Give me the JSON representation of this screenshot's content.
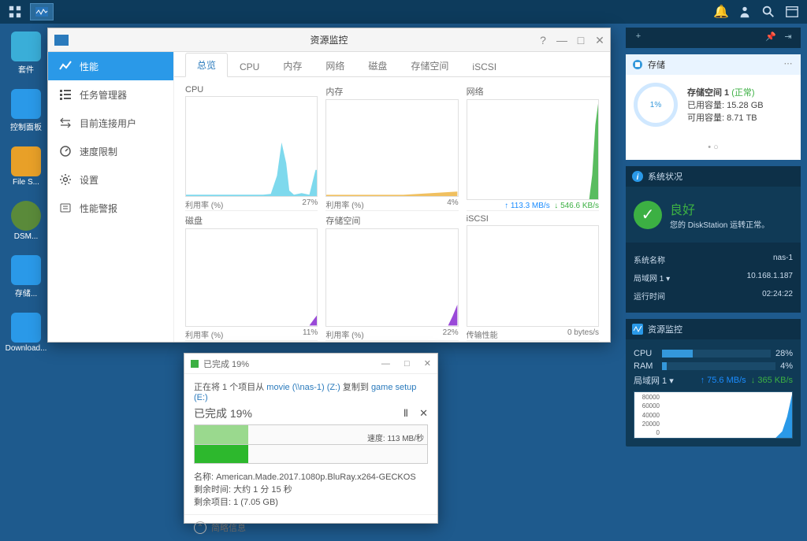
{
  "taskbar": {},
  "desktop": {
    "icons": [
      "套件",
      "控制面板",
      "File S...",
      "DSM...",
      "存储...",
      "Download..."
    ]
  },
  "main_window": {
    "title": "资源监控",
    "sidebar": [
      {
        "label": "性能",
        "active": true
      },
      {
        "label": "任务管理器"
      },
      {
        "label": "目前连接用户"
      },
      {
        "label": "速度限制"
      },
      {
        "label": "设置"
      },
      {
        "label": "性能警报"
      }
    ],
    "tabs": [
      "总览",
      "CPU",
      "内存",
      "网络",
      "磁盘",
      "存储空间",
      "iSCSI"
    ],
    "active_tab": 0,
    "charts": [
      {
        "title": "CPU",
        "foot_l": "利用率 (%)",
        "foot_r": "27%"
      },
      {
        "title": "内存",
        "foot_l": "利用率 (%)",
        "foot_r": "4%"
      },
      {
        "title": "网络",
        "foot_up": "113.3 MB/s",
        "foot_dn": "546.6 KB/s"
      },
      {
        "title": "磁盘",
        "foot_l": "利用率 (%)",
        "foot_r": "11%"
      },
      {
        "title": "存储空间",
        "foot_l": "利用率 (%)",
        "foot_r": "22%"
      },
      {
        "title": "iSCSI",
        "foot_l": "传输性能",
        "foot_r": "0 bytes/s"
      }
    ]
  },
  "copy_dialog": {
    "title": "已完成 19%",
    "line1_a": "正在将 1 个项目从 ",
    "src": "movie (\\\\nas-1) (Z:)",
    "line1_b": " 复制到 ",
    "dst": "game setup (E:)",
    "progress_label": "已完成 19%",
    "speed_label": "速度: 113 MB/秒",
    "name_label": "名称: American.Made.2017.1080p.BluRay.x264-GECKOS",
    "remain_time": "剩余时间: 大约 1 分 15 秒",
    "remain_items": "剩余项目: 1 (7.05 GB)",
    "brief": "简略信息"
  },
  "storage_panel": {
    "title": "存储",
    "vol_name": "存储空间 1",
    "status": "(正常)",
    "used": "已用容量: 15.28 GB",
    "avail": "可用容量: 8.71 TB",
    "pct": "1%"
  },
  "sys_panel": {
    "title": "系统状况",
    "status": "良好",
    "msg": "您的 DiskStation 运转正常。",
    "rows": [
      {
        "k": "系统名称",
        "v": "nas-1"
      },
      {
        "k": "局域网 1 ▾",
        "v": "10.168.1.187"
      },
      {
        "k": "运行时间",
        "v": "02:24:22"
      }
    ]
  },
  "res_panel": {
    "title": "资源监控",
    "cpu": {
      "label": "CPU",
      "pct": "28%",
      "val": 28
    },
    "ram": {
      "label": "RAM",
      "pct": "4%",
      "val": 4
    },
    "net": {
      "label": "局域网 1 ▾",
      "up": "75.6 MB/s",
      "dn": "365 KB/s"
    },
    "ylabels": [
      "80000",
      "60000",
      "40000",
      "20000",
      "0"
    ]
  },
  "chart_data": [
    {
      "type": "area",
      "title": "CPU",
      "ylabel": "利用率 (%)",
      "ylim": [
        0,
        100
      ],
      "values": [
        1,
        1,
        1,
        1,
        1,
        1,
        1,
        1,
        1,
        1,
        1,
        1,
        2,
        2,
        2,
        2,
        2,
        2,
        2,
        2,
        4,
        20,
        45,
        30,
        5,
        2,
        1,
        2,
        1,
        27
      ]
    },
    {
      "type": "area",
      "title": "内存",
      "ylabel": "利用率 (%)",
      "ylim": [
        0,
        100
      ],
      "values": [
        2,
        2,
        2,
        2,
        2,
        2,
        2,
        2,
        2,
        2,
        2,
        2,
        2,
        2,
        2,
        2,
        2,
        2,
        2,
        2,
        3,
        3,
        3,
        4,
        4,
        4,
        4,
        4,
        4,
        4
      ]
    },
    {
      "type": "area",
      "title": "网络",
      "series": [
        {
          "name": "up",
          "values": [
            0,
            0,
            0,
            0,
            0,
            0,
            0,
            0,
            0,
            0,
            0,
            0,
            0,
            0,
            0,
            0,
            0,
            0,
            0,
            0,
            0,
            0,
            0,
            0,
            0,
            0,
            0,
            20,
            80,
            113.3
          ]
        },
        {
          "name": "down",
          "values": [
            0,
            0,
            0,
            0,
            0,
            0,
            0,
            0,
            0,
            0,
            0,
            0,
            0,
            0,
            0,
            0,
            0,
            0,
            0,
            0,
            0,
            0,
            0,
            0,
            0,
            0,
            0,
            0.2,
            0.4,
            0.55
          ]
        }
      ]
    },
    {
      "type": "area",
      "title": "磁盘",
      "ylabel": "利用率 (%)",
      "ylim": [
        0,
        100
      ],
      "values": [
        0,
        0,
        0,
        0,
        0,
        0,
        0,
        0,
        0,
        0,
        0,
        0,
        0,
        0,
        0,
        0,
        0,
        0,
        0,
        0,
        0,
        0,
        0,
        0,
        0,
        0,
        0,
        2,
        6,
        11
      ]
    },
    {
      "type": "area",
      "title": "存储空间",
      "ylabel": "利用率 (%)",
      "ylim": [
        0,
        100
      ],
      "values": [
        0,
        0,
        0,
        0,
        0,
        0,
        0,
        0,
        0,
        0,
        0,
        0,
        0,
        0,
        0,
        0,
        0,
        0,
        0,
        0,
        0,
        0,
        0,
        0,
        0,
        0,
        0,
        5,
        12,
        22
      ]
    },
    {
      "type": "line",
      "title": "iSCSI",
      "ylabel": "传输性能",
      "values": [
        0,
        0,
        0,
        0,
        0,
        0,
        0,
        0,
        0,
        0,
        0,
        0,
        0,
        0,
        0,
        0,
        0,
        0,
        0,
        0,
        0,
        0,
        0,
        0,
        0,
        0,
        0,
        0,
        0,
        0
      ]
    }
  ]
}
